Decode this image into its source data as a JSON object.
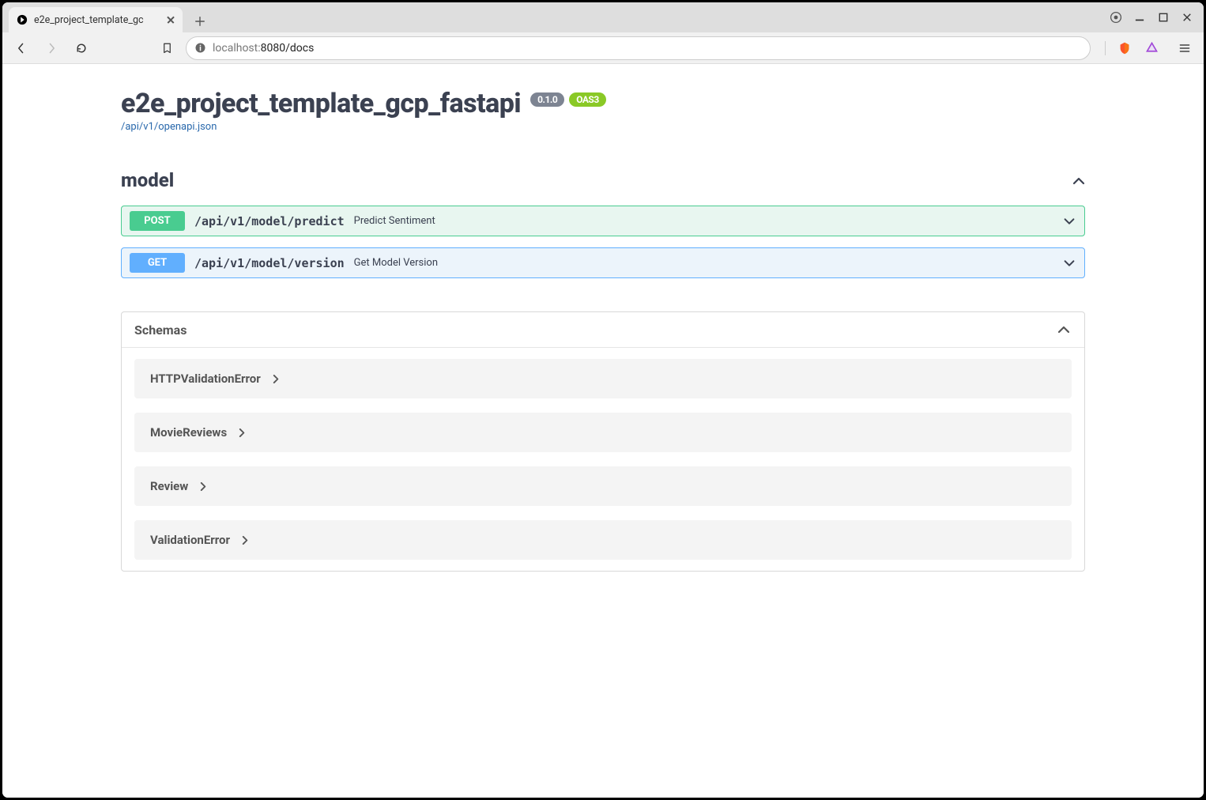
{
  "browser": {
    "tab_title": "e2e_project_template_gc",
    "url_host": "localhost:",
    "url_port_path": "8080/docs"
  },
  "swagger": {
    "title": "e2e_project_template_gcp_fastapi",
    "version_badge": "0.1.0",
    "oas_badge": "OAS3",
    "openapi_link": "/api/v1/openapi.json",
    "tag_name": "model",
    "endpoints": [
      {
        "method": "POST",
        "path": "/api/v1/model/predict",
        "summary": "Predict Sentiment"
      },
      {
        "method": "GET",
        "path": "/api/v1/model/version",
        "summary": "Get Model Version"
      }
    ],
    "schemas_title": "Schemas",
    "schemas": [
      "HTTPValidationError",
      "MovieReviews",
      "Review",
      "ValidationError"
    ]
  }
}
